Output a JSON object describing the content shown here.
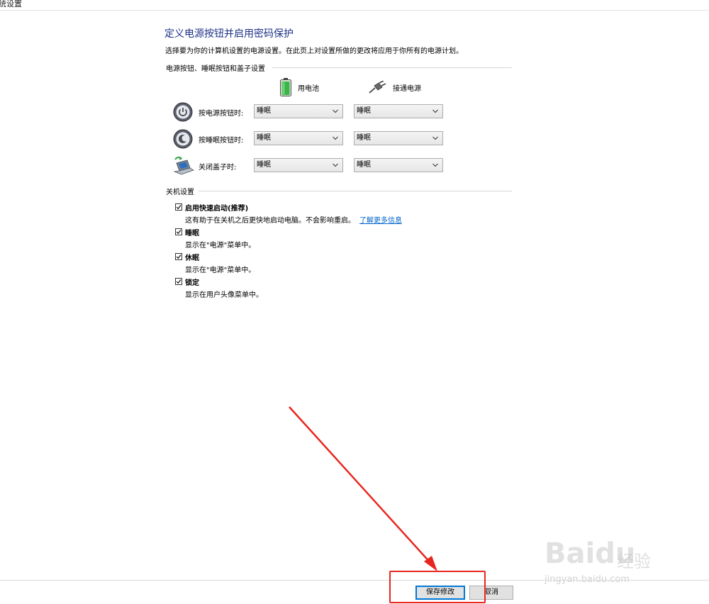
{
  "window": {
    "title": "统设置"
  },
  "page": {
    "heading": "定义电源按钮并启用密码保护",
    "description": "选择要为你的计算机设置的电源设置。在此页上对设置所做的更改将应用于你所有的电源计划。"
  },
  "power_buttons": {
    "section_title": "电源按钮、睡眠按钮和盖子设置",
    "columns": {
      "battery": "用电池",
      "plugged_in": "接通电源"
    },
    "rows": [
      {
        "label": "按电源按钮时:",
        "battery": "睡眠",
        "plugged_in": "睡眠"
      },
      {
        "label": "按睡眠按钮时:",
        "battery": "睡眠",
        "plugged_in": "睡眠"
      },
      {
        "label": "关闭盖子时:",
        "battery": "睡眠",
        "plugged_in": "睡眠"
      }
    ]
  },
  "shutdown": {
    "section_title": "关机设置",
    "items": [
      {
        "label": "启用快速启动(推荐)",
        "description": "这有助于在关机之后更快地启动电脑。不会影响重启。",
        "link": "了解更多信息",
        "checked": true
      },
      {
        "label": "睡眠",
        "description": "显示在\"电源\"菜单中。",
        "checked": true
      },
      {
        "label": "休眠",
        "description": "显示在\"电源\"菜单中。",
        "checked": true
      },
      {
        "label": "锁定",
        "description": "显示在用户头像菜单中。",
        "checked": true
      }
    ]
  },
  "footer": {
    "save_label": "保存修改",
    "cancel_label": "取消"
  },
  "watermark": {
    "brand": "Bai",
    "brand_suffix": "du",
    "cn": "经验",
    "url": "jingyan.baidu.com"
  },
  "colors": {
    "heading": "#1e3287",
    "link": "#0066cc",
    "annotation": "#e8261f"
  }
}
